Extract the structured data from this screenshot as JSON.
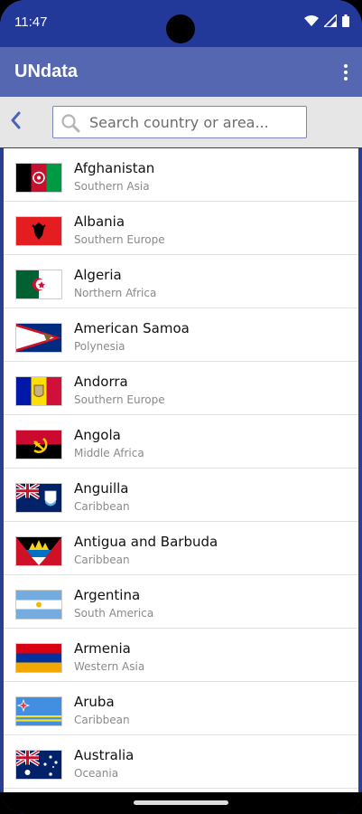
{
  "status": {
    "time": "11:47"
  },
  "app": {
    "title": "UNdata"
  },
  "search": {
    "placeholder": "Search country or area..."
  },
  "colors": {
    "statusbar": "#23399a",
    "appbar": "#5667b2",
    "search_bg": "#e6e6e6"
  },
  "countries": [
    {
      "name": "Afghanistan",
      "region": "Southern Asia"
    },
    {
      "name": "Albania",
      "region": "Southern Europe"
    },
    {
      "name": "Algeria",
      "region": "Northern Africa"
    },
    {
      "name": "American Samoa",
      "region": "Polynesia"
    },
    {
      "name": "Andorra",
      "region": "Southern Europe"
    },
    {
      "name": "Angola",
      "region": "Middle Africa"
    },
    {
      "name": "Anguilla",
      "region": "Caribbean"
    },
    {
      "name": "Antigua and Barbuda",
      "region": "Caribbean"
    },
    {
      "name": "Argentina",
      "region": "South America"
    },
    {
      "name": "Armenia",
      "region": "Western Asia"
    },
    {
      "name": "Aruba",
      "region": "Caribbean"
    },
    {
      "name": "Australia",
      "region": "Oceania"
    }
  ]
}
